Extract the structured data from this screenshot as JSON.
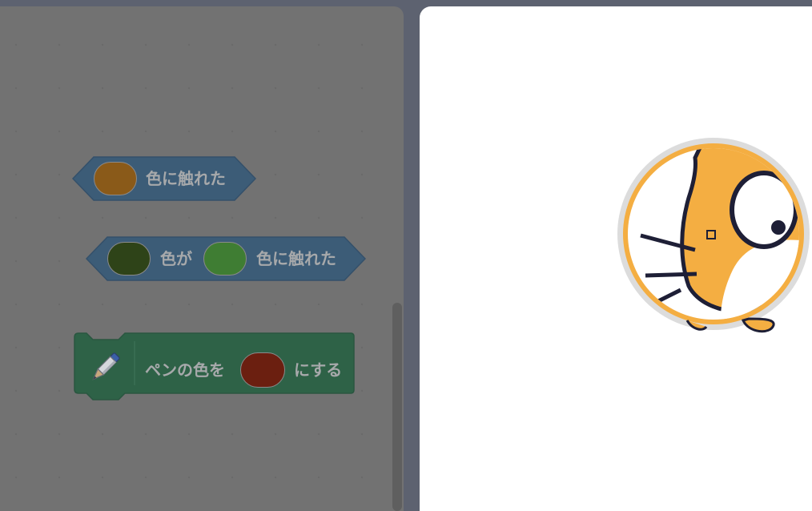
{
  "workspace": {
    "blocks": [
      {
        "id": "touching-color",
        "type": "sensing-boolean",
        "label": "色に触れた",
        "swatch_color": "#8a5a19"
      },
      {
        "id": "color-touching-color",
        "type": "sensing-boolean",
        "label_mid": "色が",
        "label_end": "色に触れた",
        "swatch1_color": "#2e4318",
        "swatch2_color": "#3f7d33"
      },
      {
        "id": "set-pen-color",
        "type": "pen-command",
        "label_start": "ペンの色を",
        "label_end": "にする",
        "swatch_color": "#6b1f10",
        "icon": "pen-icon"
      }
    ]
  },
  "colors": {
    "sensing_block": "#3c5c77",
    "pen_block": "#2e6247",
    "workspace_bg": "#727272",
    "stage_bg": "#ffffff",
    "sprite_orange": "#f4ae42"
  },
  "stage": {
    "sprite": "scratch-cat-sprite"
  }
}
